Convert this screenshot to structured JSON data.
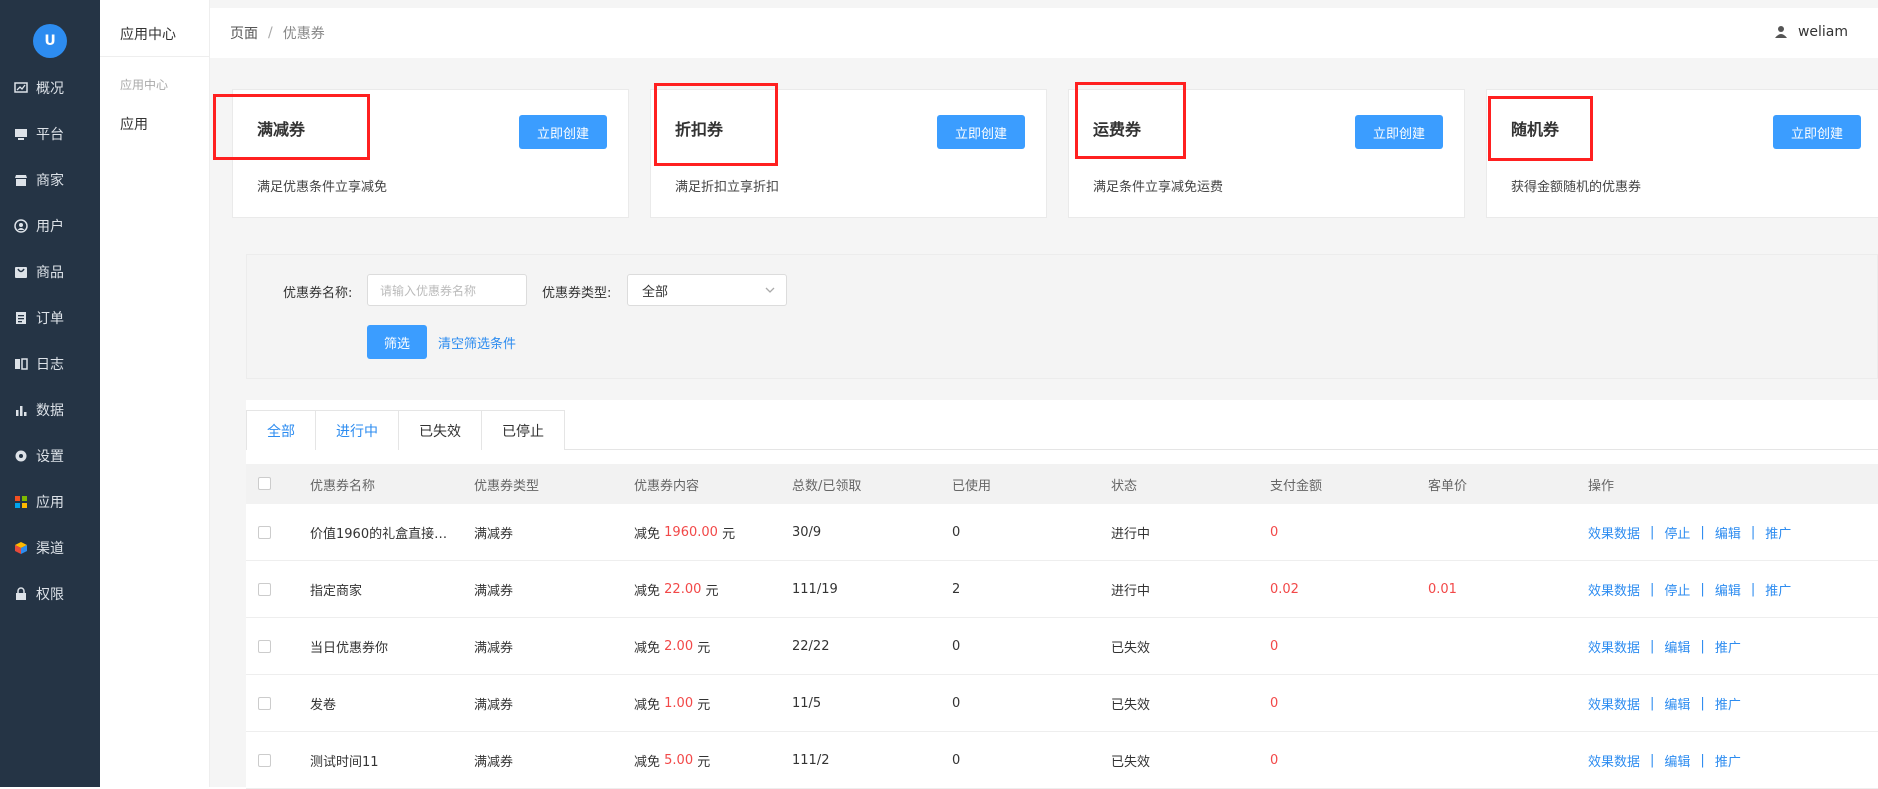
{
  "sidebar": {
    "logo_text": "U",
    "items": [
      {
        "label": "概况",
        "icon": "chart-icon"
      },
      {
        "label": "平台",
        "icon": "monitor-icon"
      },
      {
        "label": "商家",
        "icon": "store-icon"
      },
      {
        "label": "用户",
        "icon": "user-icon"
      },
      {
        "label": "商品",
        "icon": "bag-icon"
      },
      {
        "label": "订单",
        "icon": "clipboard-icon"
      },
      {
        "label": "日志",
        "icon": "book-icon"
      },
      {
        "label": "数据",
        "icon": "bar-chart-icon"
      },
      {
        "label": "设置",
        "icon": "gear-icon"
      },
      {
        "label": "应用",
        "icon": "apps-icon"
      },
      {
        "label": "渠道",
        "icon": "cube-icon"
      },
      {
        "label": "权限",
        "icon": "lock-icon"
      }
    ]
  },
  "subnav": {
    "header": "应用中心",
    "group": "应用中心",
    "item": "应用"
  },
  "topbar": {
    "breadcrumb_home": "页面",
    "breadcrumb_current": "优惠券",
    "username": "weliam"
  },
  "cards": [
    {
      "title": "满减券",
      "desc": "满足优惠条件立享减免",
      "button": "立即创建"
    },
    {
      "title": "折扣券",
      "desc": "满足折扣立享折扣",
      "button": "立即创建"
    },
    {
      "title": "运费券",
      "desc": "满足条件立享减免运费",
      "button": "立即创建"
    },
    {
      "title": "随机券",
      "desc": "获得金额随机的优惠券",
      "button": "立即创建"
    }
  ],
  "filter": {
    "name_label": "优惠券名称:",
    "name_placeholder": "请输入优惠券名称",
    "type_label": "优惠券类型:",
    "type_value": "全部",
    "submit": "筛选",
    "clear": "清空筛选条件"
  },
  "tabs": [
    "全部",
    "进行中",
    "已失效",
    "已停止"
  ],
  "table": {
    "headers": [
      "优惠券名称",
      "优惠券类型",
      "优惠券内容",
      "总数/已领取",
      "已使用",
      "状态",
      "支付金额",
      "客单价",
      "操作"
    ],
    "content_prefix": "减免",
    "content_suffix": "元",
    "rows": [
      {
        "name": "价值1960的礼盒直接…",
        "type": "满减券",
        "amount": "1960.00",
        "total": "30/9",
        "used": "0",
        "status": "进行中",
        "pay": "0",
        "avg": "",
        "ops": [
          "效果数据",
          "停止",
          "编辑",
          "推广"
        ]
      },
      {
        "name": "指定商家",
        "type": "满减券",
        "amount": "22.00",
        "total": "111/19",
        "used": "2",
        "status": "进行中",
        "pay": "0.02",
        "avg": "0.01",
        "ops": [
          "效果数据",
          "停止",
          "编辑",
          "推广"
        ]
      },
      {
        "name": "当日优惠券你",
        "type": "满减券",
        "amount": "2.00",
        "total": "22/22",
        "used": "0",
        "status": "已失效",
        "pay": "0",
        "avg": "",
        "ops": [
          "效果数据",
          "编辑",
          "推广"
        ]
      },
      {
        "name": "发卷",
        "type": "满减券",
        "amount": "1.00",
        "total": "11/5",
        "used": "0",
        "status": "已失效",
        "pay": "0",
        "avg": "",
        "ops": [
          "效果数据",
          "编辑",
          "推广"
        ]
      },
      {
        "name": "测试时间11",
        "type": "满减券",
        "amount": "5.00",
        "total": "111/2",
        "used": "0",
        "status": "已失效",
        "pay": "0",
        "avg": "",
        "ops": [
          "效果数据",
          "编辑",
          "推广"
        ]
      }
    ]
  },
  "colors": {
    "sidebar_bg": "#253445",
    "primary": "#3b9dff",
    "link": "#2d8cf0",
    "price_red": "#f24848",
    "highlight_box": "#ff2020"
  }
}
